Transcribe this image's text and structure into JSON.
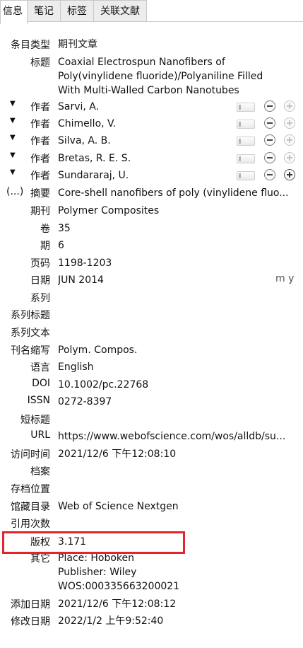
{
  "tabs": [
    {
      "label": "信息"
    },
    {
      "label": "笔记"
    },
    {
      "label": "标签"
    },
    {
      "label": "关联文献"
    }
  ],
  "item_type": {
    "label": "条目类型",
    "value": "期刊文章"
  },
  "title": {
    "label": "标题",
    "line1": "Coaxial Electrospun Nanofibers of",
    "line2": "Poly(vinylidene fluoride)/Polyaniline Filled",
    "line3": "With Multi-Walled Carbon Nanotubes"
  },
  "creators": [
    {
      "toggle": "▼",
      "label": "作者",
      "name": "Sarvi, A."
    },
    {
      "toggle": "▼",
      "label": "作者",
      "name": "Chimello, V."
    },
    {
      "toggle": "▼",
      "label": "作者",
      "name": "Silva, A. B."
    },
    {
      "toggle": "▼",
      "label": "作者",
      "name": "Bretas, R. E. S."
    },
    {
      "toggle": "▼",
      "label": "作者",
      "name": "Sundararaj, U."
    }
  ],
  "abstract": {
    "prefix": "(...)",
    "label": "摘要",
    "value": "Core-shell nanofibers of poly (vinylidene fluo..."
  },
  "publication": {
    "label": "期刊",
    "value": "Polymer Composites"
  },
  "volume": {
    "label": "卷",
    "value": "35"
  },
  "issue": {
    "label": "期",
    "value": "6"
  },
  "pages": {
    "label": "页码",
    "value": "1198-1203"
  },
  "date": {
    "label": "日期",
    "value": "JUN 2014",
    "hint": "m y"
  },
  "series": {
    "label": "系列",
    "value": ""
  },
  "series_title": {
    "label": "系列标题",
    "value": ""
  },
  "series_text": {
    "label": "系列文本",
    "value": ""
  },
  "journal_abbr": {
    "label": "刊名缩写",
    "value": "Polym. Compos."
  },
  "language": {
    "label": "语言",
    "value": "English"
  },
  "doi": {
    "label": "DOI",
    "value": "10.1002/pc.22768"
  },
  "issn": {
    "label": "ISSN",
    "value": "0272-8397"
  },
  "short_title": {
    "label": "短标题",
    "value": ""
  },
  "url": {
    "label": "URL",
    "value": "https://www.webofscience.com/wos/alldb/su..."
  },
  "accessed": {
    "label": "访问时间",
    "value": "2021/12/6 下午12:08:10"
  },
  "archive": {
    "label": "档案",
    "value": ""
  },
  "archive_location": {
    "label": "存档位置",
    "value": ""
  },
  "library_catalog": {
    "label": "馆藏目录",
    "value": "Web of Science Nextgen"
  },
  "call_number": {
    "label": "引用次数",
    "value": ""
  },
  "rights": {
    "label": "版权",
    "value": "3.171"
  },
  "extra": {
    "label": "其它",
    "line1": "Place: Hoboken",
    "line2": "Publisher: Wiley",
    "line3": "WOS:000335663200021"
  },
  "date_added": {
    "label": "添加日期",
    "value": "2021/12/6 下午12:08:12"
  },
  "date_modified": {
    "label": "修改日期",
    "value": "2022/1/2 上午9:52:40"
  },
  "colors": {
    "highlight": "#e3242b",
    "tab_bg": "#ececec",
    "border": "#c9c9c9"
  },
  "icons": [
    "triangle-down-icon",
    "swap-name-icon",
    "minus-circle-icon",
    "plus-circle-icon"
  ]
}
